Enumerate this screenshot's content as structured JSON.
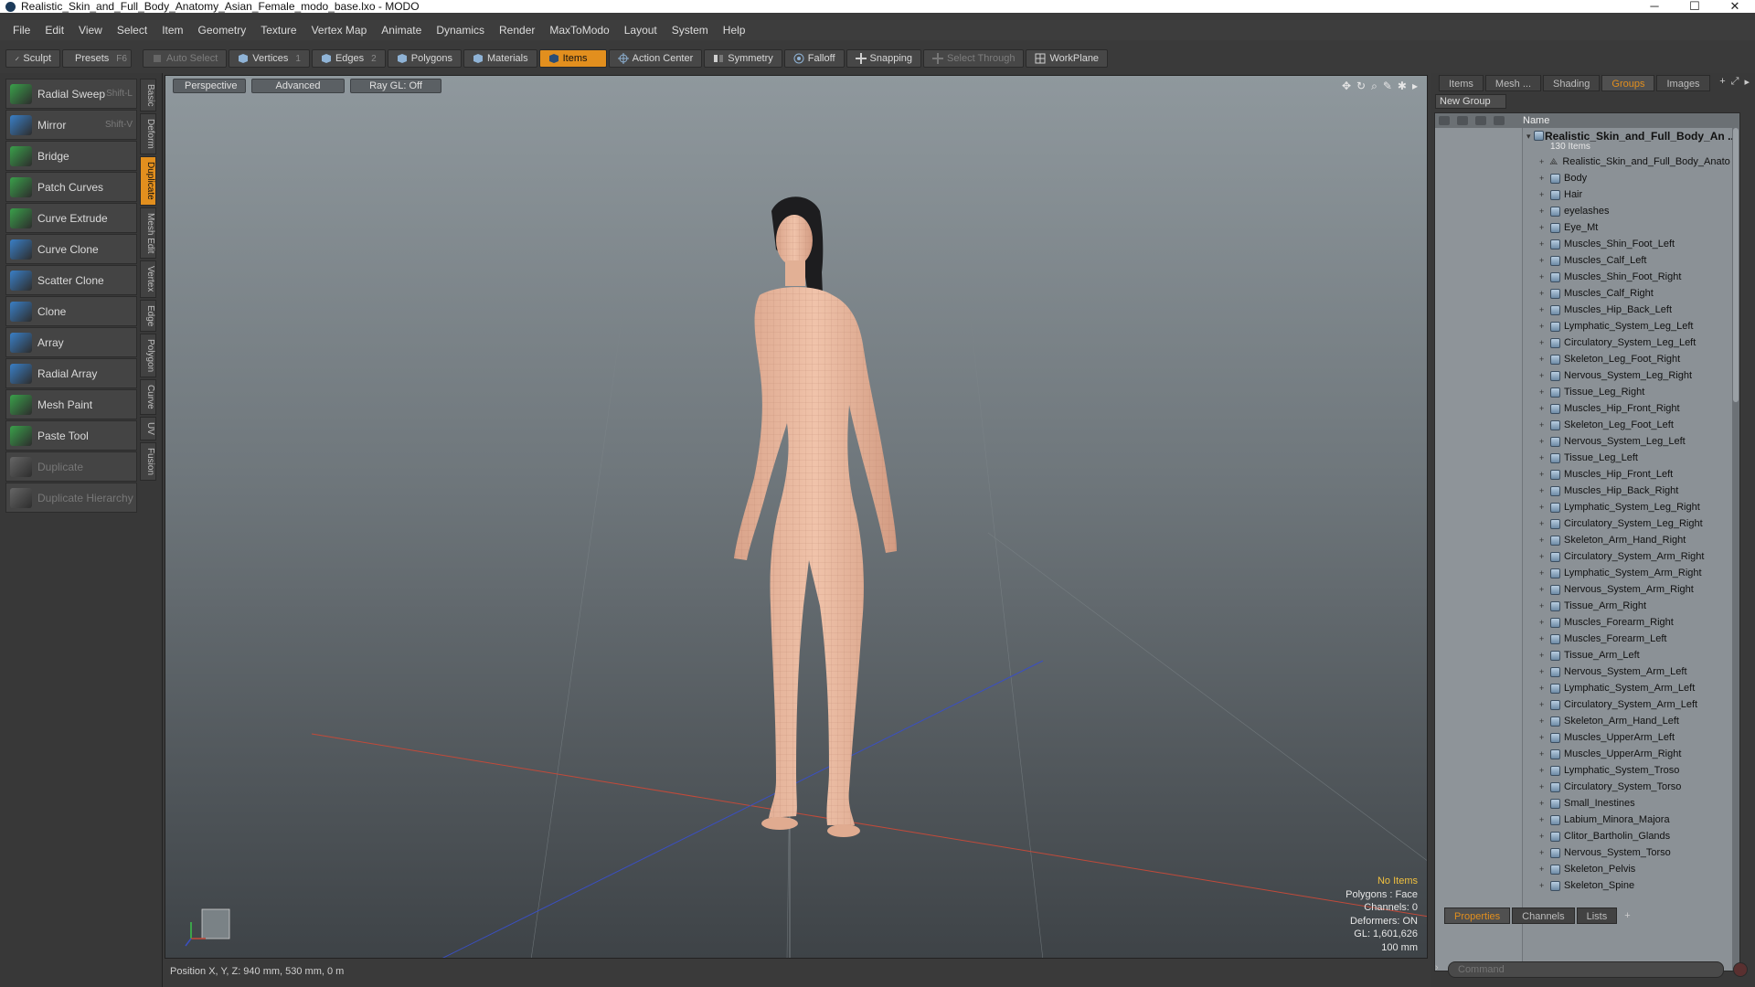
{
  "window": {
    "title": "Realistic_Skin_and_Full_Body_Anatomy_Asian_Female_modo_base.lxo - MODO",
    "minimize": "─",
    "maximize": "☐",
    "close": "✕"
  },
  "menu": [
    "File",
    "Edit",
    "View",
    "Select",
    "Item",
    "Geometry",
    "Texture",
    "Vertex Map",
    "Animate",
    "Dynamics",
    "Render",
    "MaxToModo",
    "Layout",
    "System",
    "Help"
  ],
  "toolbar": {
    "sculpt": "Sculpt",
    "presets": "Presets",
    "presets_sc": "F6",
    "auto_select": "Auto Select",
    "vertices": "Vertices",
    "vertices_num": "1",
    "edges": "Edges",
    "edges_num": "2",
    "polygons": "Polygons",
    "materials": "Materials",
    "items": "Items",
    "action_center": "Action Center",
    "symmetry": "Symmetry",
    "falloff": "Falloff",
    "snapping": "Snapping",
    "select_through": "Select Through",
    "workplane": "WorkPlane"
  },
  "tools": [
    {
      "label": "Radial Sweep",
      "shortcut": "Shift-L",
      "color": "#3aa04a"
    },
    {
      "label": "Mirror",
      "shortcut": "Shift-V",
      "color": "#3a7fc6"
    },
    {
      "label": "Bridge",
      "shortcut": "",
      "color": "#3aa04a"
    },
    {
      "label": "Patch Curves",
      "shortcut": "",
      "color": "#3aa04a"
    },
    {
      "label": "Curve Extrude",
      "shortcut": "",
      "color": "#3aa04a"
    },
    {
      "label": "Curve Clone",
      "shortcut": "",
      "color": "#3a7fc6"
    },
    {
      "label": "Scatter Clone",
      "shortcut": "",
      "color": "#3a7fc6"
    },
    {
      "label": "Clone",
      "shortcut": "",
      "color": "#3a7fc6"
    },
    {
      "label": "Array",
      "shortcut": "",
      "color": "#3a7fc6"
    },
    {
      "label": "Radial Array",
      "shortcut": "",
      "color": "#3a7fc6"
    },
    {
      "label": "Mesh Paint",
      "shortcut": "",
      "color": "#3aa04a"
    },
    {
      "label": "Paste Tool",
      "shortcut": "",
      "color": "#3aa04a"
    },
    {
      "label": "Duplicate",
      "shortcut": "",
      "color": "#666666"
    },
    {
      "label": "Duplicate Hierarchy",
      "shortcut": "",
      "color": "#666666"
    }
  ],
  "vtabs": [
    "Basic",
    "Deform",
    "Duplicate",
    "Mesh Edit",
    "Vertex",
    "Edge",
    "Polygon",
    "Curve",
    "UV",
    "Fusion"
  ],
  "viewport": {
    "view_mode": "Perspective",
    "shading": "Advanced",
    "raygl": "Ray GL: Off",
    "info": {
      "selection": "No Items",
      "polygons": "Polygons : Face",
      "channels": "Channels: 0",
      "deformers": "Deformers: ON",
      "gl": "GL: 1,601,626",
      "scale": "100 mm"
    }
  },
  "status": "Position X, Y, Z:  940 mm, 530 mm, 0 m",
  "right_tabs": [
    "Items",
    "Mesh ...",
    "Shading",
    "Groups",
    "Images"
  ],
  "new_group": "New Group",
  "tree": {
    "name_header": "Name",
    "root_title": "Realistic_Skin_and_Full_Body_An ...",
    "root_count": "130 Items",
    "mesh_item": "Realistic_Skin_and_Full_Body_Anato ...",
    "groups": [
      "Body",
      "Hair",
      "eyelashes",
      "Eye_Mt",
      "Muscles_Shin_Foot_Left",
      "Muscles_Calf_Left",
      "Muscles_Shin_Foot_Right",
      "Muscles_Calf_Right",
      "Muscles_Hip_Back_Left",
      "Lymphatic_System_Leg_Left",
      "Circulatory_System_Leg_Left",
      "Skeleton_Leg_Foot_Right",
      "Nervous_System_Leg_Right",
      "Tissue_Leg_Right",
      "Muscles_Hip_Front_Right",
      "Skeleton_Leg_Foot_Left",
      "Nervous_System_Leg_Left",
      "Tissue_Leg_Left",
      "Muscles_Hip_Front_Left",
      "Muscles_Hip_Back_Right",
      "Lymphatic_System_Leg_Right",
      "Circulatory_System_Leg_Right",
      "Skeleton_Arm_Hand_Right",
      "Circulatory_System_Arm_Right",
      "Lymphatic_System_Arm_Right",
      "Nervous_System_Arm_Right",
      "Tissue_Arm_Right",
      "Muscles_Forearm_Right",
      "Muscles_Forearm_Left",
      "Tissue_Arm_Left",
      "Nervous_System_Arm_Left",
      "Lymphatic_System_Arm_Left",
      "Circulatory_System_Arm_Left",
      "Skeleton_Arm_Hand_Left",
      "Muscles_UpperArm_Left",
      "Muscles_UpperArm_Right",
      "Lymphatic_System_Troso",
      "Circulatory_System_Torso",
      "Small_Inestines",
      "Labium_Minora_Majora",
      "Clitor_Bartholin_Glands",
      "Nervous_System_Torso",
      "Skeleton_Pelvis",
      "Skeleton_Spine"
    ]
  },
  "bottom_tabs": [
    "Properties",
    "Channels",
    "Lists"
  ],
  "command_placeholder": "Command",
  "colors": {
    "accent": "#e28f1e",
    "skin": "#e8b9a0",
    "hair": "#1d1d1f"
  }
}
